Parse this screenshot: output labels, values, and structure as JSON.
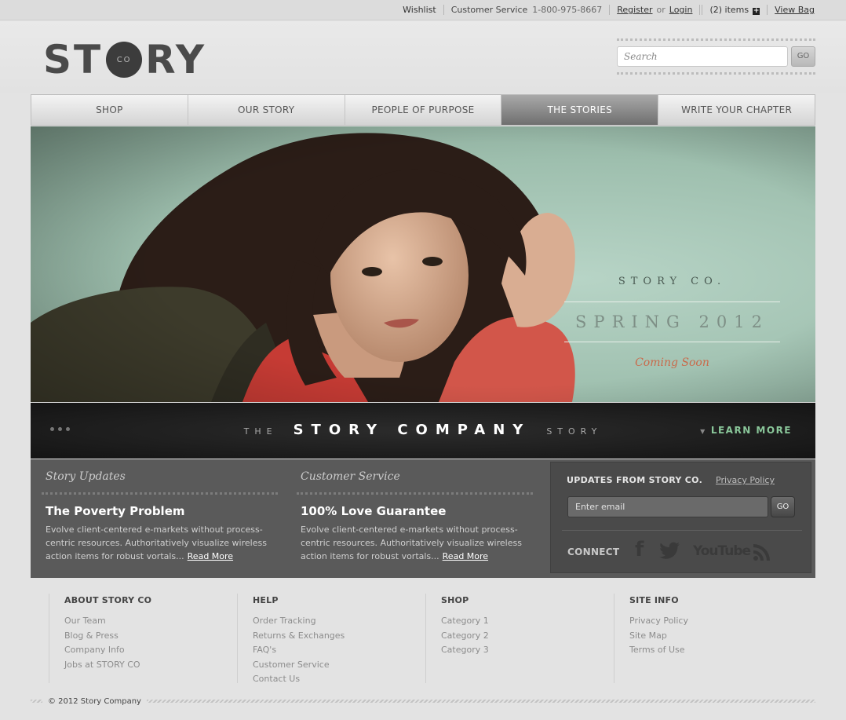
{
  "topbar": {
    "wishlist": "Wishlist",
    "customer_service_label": "Customer Service",
    "phone": "1-800-975-8667",
    "register": "Register",
    "or": "or",
    "login": "Login",
    "items": "(2) items",
    "view_bag": "View Bag"
  },
  "header": {
    "logo_left": "ST",
    "logo_center": "CO",
    "logo_right": "RY",
    "search_placeholder": "Search",
    "search_go": "GO"
  },
  "nav": {
    "items": [
      {
        "label": "SHOP"
      },
      {
        "label": "OUR STORY"
      },
      {
        "label": "PEOPLE OF PURPOSE"
      },
      {
        "label": "THE STORIES",
        "active": true
      },
      {
        "label": "WRITE YOUR CHAPTER"
      }
    ]
  },
  "hero": {
    "brand": "STORY CO.",
    "season": "SPRING 2012",
    "status": "Coming Soon"
  },
  "banner": {
    "pre": "THE",
    "main": "STORY COMPANY",
    "post": "STORY",
    "learn_more": "LEARN MORE"
  },
  "info": {
    "columns": [
      {
        "title": "Story Updates",
        "headline": "The Poverty Problem",
        "body": "Evolve client-centered e-markets without process-centric resources. Authoritatively visualize wireless action items for robust vortals...",
        "read_more": "Read More"
      },
      {
        "title": "Customer Service",
        "headline": "100% Love Guarantee",
        "body": "Evolve client-centered e-markets without process-centric resources. Authoritatively visualize wireless action items for robust vortals...",
        "read_more": "Read More"
      }
    ],
    "updates_title": "UPDATES FROM STORY CO.",
    "privacy_policy": "Privacy Policy",
    "email_placeholder": "Enter email",
    "email_go": "GO",
    "connect": "CONNECT",
    "social": {
      "facebook": "f",
      "youtube": "YouTube"
    }
  },
  "footer": {
    "columns": [
      {
        "title": "ABOUT STORY CO",
        "links": [
          "Our Team",
          "Blog & Press",
          "Company Info",
          "Jobs at STORY CO"
        ]
      },
      {
        "title": "HELP",
        "links": [
          "Order Tracking",
          "Returns & Exchanges",
          "FAQ's",
          "Customer Service",
          "Contact Us"
        ]
      },
      {
        "title": "SHOP",
        "links": [
          "Category 1",
          "Category 2",
          "Category 3"
        ]
      },
      {
        "title": "SITE INFO",
        "links": [
          "Privacy Policy",
          "Site Map",
          "Terms of Use"
        ]
      }
    ],
    "copyright": "© 2012 Story Company"
  },
  "colors": {
    "background": "#e3e3e3",
    "dark_panel": "#5a5a5a",
    "banner": "#1f1f1f",
    "accent_green": "#8ac79a",
    "accent_coral": "#c96a4b",
    "hero_mint": "#b7d4c6"
  }
}
